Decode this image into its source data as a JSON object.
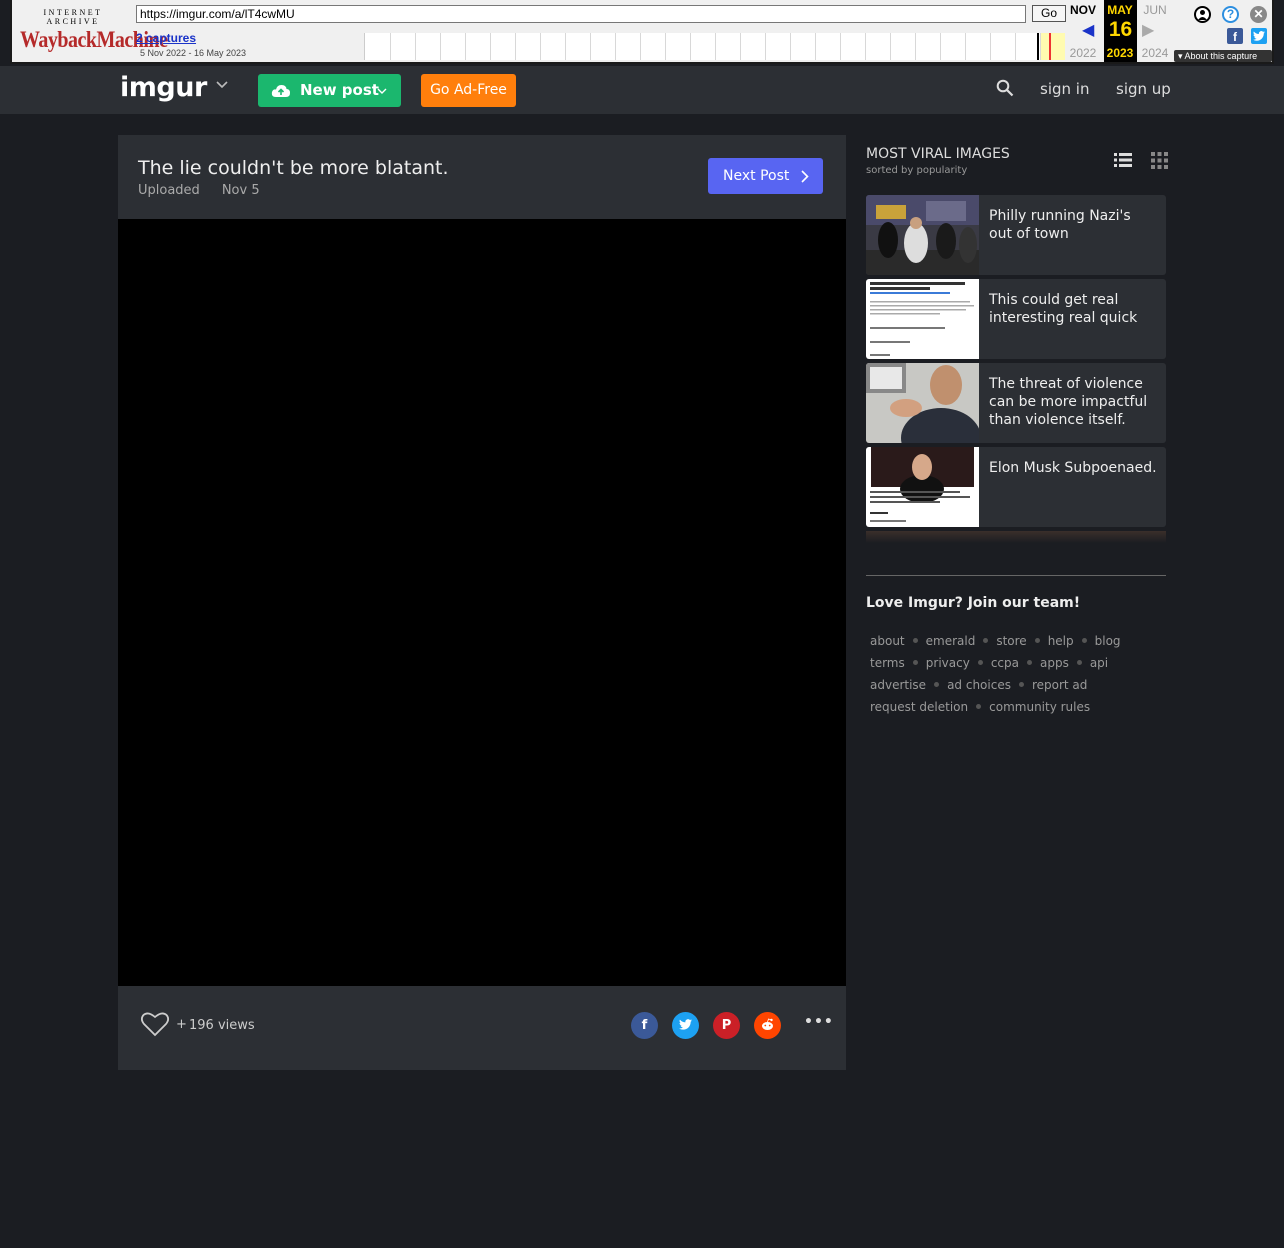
{
  "wayback": {
    "logo_top": "INTERNET ARCHIVE",
    "logo_main": "WaybackMachine",
    "url": "https://imgur.com/a/lT4cwMU",
    "go_label": "Go",
    "captures": "2 captures",
    "range": "5 Nov 2022 - 16 May 2023",
    "prev_month": "NOV",
    "prev_year": "2022",
    "cur_month": "MAY",
    "cur_day": "16",
    "cur_year": "2023",
    "next_month": "JUN",
    "next_year": "2024",
    "about_label": "About this capture"
  },
  "nav": {
    "logo": "imgur",
    "new_post": "New post",
    "go_ad_free": "Go Ad-Free",
    "sign_in": "sign in",
    "sign_up": "sign up"
  },
  "post": {
    "title": "The lie couldn't be more blatant.",
    "uploaded_label": "Uploaded",
    "date": "Nov 5",
    "next_post": "Next Post",
    "plus": "+",
    "views": "196 views",
    "more": "•••"
  },
  "sidebar": {
    "title": "MOST VIRAL IMAGES",
    "subtitle": "sorted by popularity",
    "items": [
      {
        "title": "Philly running Nazi's out of town"
      },
      {
        "title": "This could get real interesting real quick"
      },
      {
        "title": "The threat of violence can be more impactful than violence itself."
      },
      {
        "title": "Elon Musk Subpoenaed."
      }
    ]
  },
  "footer": {
    "join": "Love Imgur? Join our team!",
    "rows": [
      [
        "about",
        "emerald",
        "store",
        "help",
        "blog"
      ],
      [
        "terms",
        "privacy",
        "ccpa",
        "apps",
        "api"
      ],
      [
        "advertise",
        "ad choices",
        "report ad"
      ],
      [
        "request deletion",
        "community rules"
      ]
    ]
  },
  "colors": {
    "new_post": "#1bb76e",
    "ad_free": "#ff7f0c",
    "next_post": "#5865f2",
    "facebook": "#3b5998",
    "twitter": "#1da1f2",
    "pinterest": "#cb2027",
    "reddit": "#ff4500"
  }
}
